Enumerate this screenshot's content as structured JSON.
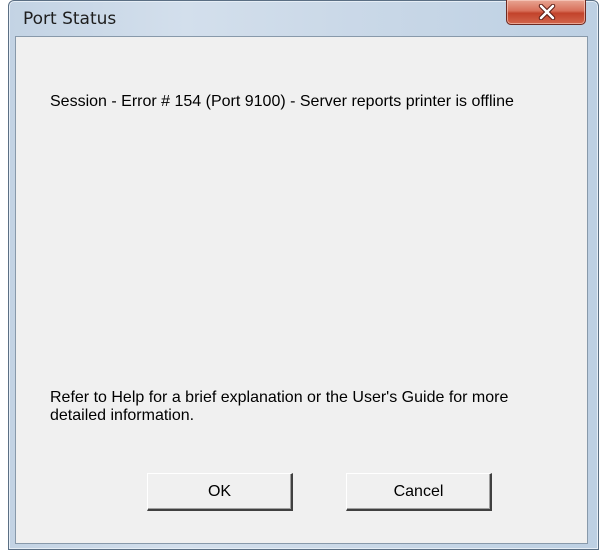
{
  "window": {
    "title": "Port Status"
  },
  "titlebar": {
    "close_icon": "close-icon"
  },
  "message": {
    "error_text": "Session - Error # 154  (Port 9100) - Server reports printer is offline",
    "help_text": "Refer to Help for a brief explanation or the User's Guide for more detailed information."
  },
  "buttons": {
    "ok_label": "OK",
    "cancel_label": "Cancel"
  },
  "colors": {
    "close_button": "#c2432b",
    "client_background": "#f0f0f0",
    "frame": "#cbd9e8"
  }
}
